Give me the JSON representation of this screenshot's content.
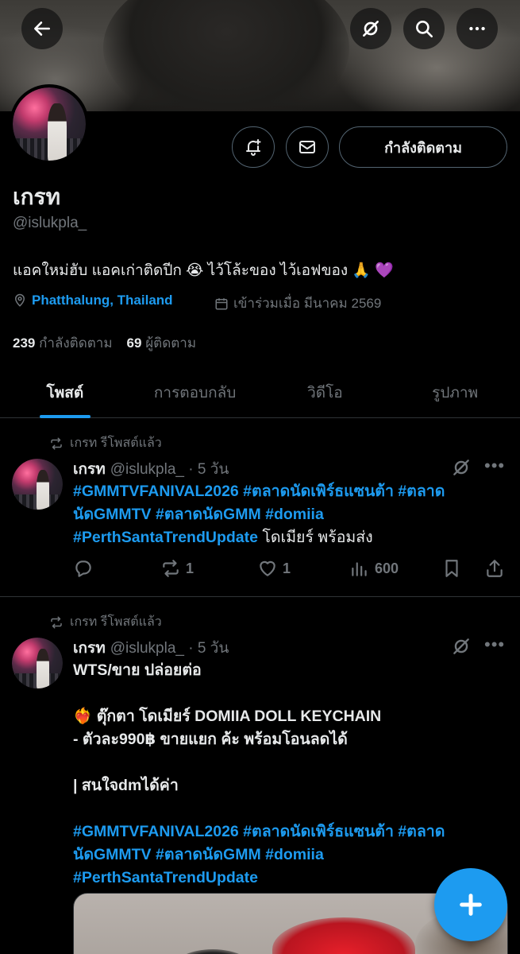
{
  "header": {
    "back_icon": "arrow-left-icon",
    "grok_icon": "grok-icon",
    "search_icon": "search-icon",
    "more_icon": "more-horizontal-icon"
  },
  "profile": {
    "display_name": "เกรท",
    "handle": "@islukpla_",
    "bio": "แอคใหม่ฮับ แอคเก่าติดปีก 😭 ไว้โล้ะของ ไว้เอฟของ 🙏 💜",
    "location": "Phatthalung, Thailand",
    "joined": "เข้าร่วมเมื่อ มีนาคม 2569",
    "following_count": "239",
    "following_label": "กำลังติดตาม",
    "followers_count": "69",
    "followers_label": "ผู้ติดตาม",
    "follow_button_label": "กำลังติดตาม"
  },
  "tabs": [
    {
      "label": "โพสต์",
      "active": true
    },
    {
      "label": "การตอบกลับ",
      "active": false
    },
    {
      "label": "วิดีโอ",
      "active": false
    },
    {
      "label": "รูปภาพ",
      "active": false
    }
  ],
  "posts": [
    {
      "repost_label": "เกรท รีโพสต์แล้ว",
      "author": "เกรท",
      "handle_time": "@islukpla_ · 5 วัน",
      "text_tags_1": "#GMMTVFANIVAL2026 #ตลาดนัดเพิร์ธแซนต้า #ตลาด",
      "text_tags_2": "นัดGMMTV #ตลาดนัดGMM #domiia",
      "text_tags_3": "#PerthSantaTrendUpdate",
      "text_tail_3": " โดเมียร์ พร้อมส่ง",
      "reply_count": "",
      "repost_count": "1",
      "like_count": "1",
      "view_count": "600"
    },
    {
      "repost_label": "เกรท รีโพสต์แล้ว",
      "author": "เกรท",
      "handle_time": "@islukpla_ · 5 วัน",
      "line1": "WTS/ขาย ปล่อยต่อ",
      "line2_emoji": "❤️‍🔥",
      "line2": " ตุ๊กตา โดเมียร์ DOMIIA DOLL KEYCHAIN",
      "line3": "-  ตัวละ990฿ ขายแยก ค้ะ  พร้อมโอนลดได้",
      "line4": "| สนใจdmได้ค่า",
      "tags_1": "#GMMTVFANIVAL2026 #ตลาดนัดเพิร์ธแซนต้า #ตลาด",
      "tags_2": "นัดGMMTV #ตลาดนัดGMM #domiia",
      "tags_3": "#PerthSantaTrendUpdate"
    }
  ],
  "fab_icon": "plus-icon",
  "colors": {
    "accent": "#1d9bf0",
    "muted": "#71767b",
    "background": "#000000",
    "divider": "#2f3336"
  }
}
